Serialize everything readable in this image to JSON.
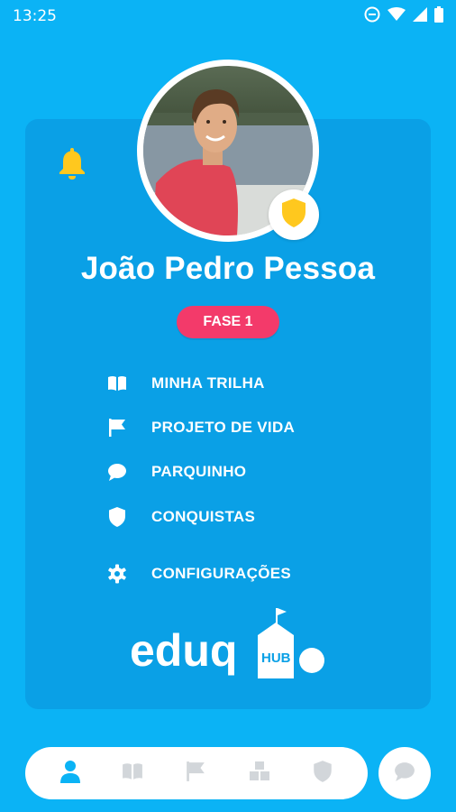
{
  "status_bar": {
    "time": "13:25",
    "icons": [
      "do-not-disturb-icon",
      "wifi-icon",
      "signal-icon",
      "battery-icon"
    ]
  },
  "profile": {
    "name": "João Pedro Pessoa",
    "phase": "FASE 1",
    "avatar": "profile-photo",
    "badge_icon": "shield-icon"
  },
  "menu": {
    "items": [
      {
        "label": "MINHA TRILHA",
        "icon": "book-icon"
      },
      {
        "label": "PROJETO DE VIDA",
        "icon": "flag-icon"
      },
      {
        "label": "PARQUINHO",
        "icon": "chat-bubble-icon"
      },
      {
        "label": "CONQUISTAS",
        "icon": "shield-icon"
      },
      {
        "label": "CONFIGURAÇÕES",
        "icon": "gear-icon"
      }
    ]
  },
  "brand": {
    "logo_text": "eduq",
    "logo_sub": "HUB"
  },
  "bottom_nav": {
    "items": [
      {
        "icon": "person-icon",
        "active": true
      },
      {
        "icon": "book-icon",
        "active": false
      },
      {
        "icon": "flag-icon",
        "active": false
      },
      {
        "icon": "blocks-icon",
        "active": false
      },
      {
        "icon": "shield-icon",
        "active": false
      }
    ],
    "chat_icon": "chat-bubble-icon"
  },
  "colors": {
    "background": "#0bb3f5",
    "card": "#0aa0e6",
    "phase_badge": "#f33a6a",
    "bell": "#ffc81e",
    "active_nav": "#0bb3f5",
    "inactive_nav": "#d2d6da"
  }
}
